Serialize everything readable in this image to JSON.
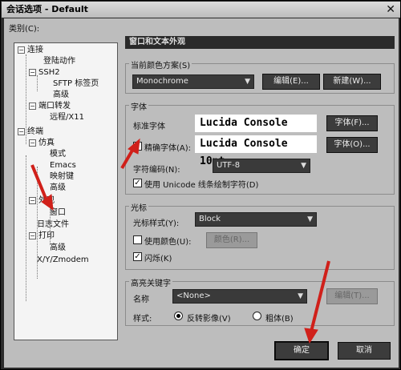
{
  "window": {
    "title": "会话选项 - Default",
    "close_glyph": "✕"
  },
  "category_label": "类别(C):",
  "tree": [
    {
      "label": "连接",
      "toggle": "−"
    },
    {
      "label": "登陆动作"
    },
    {
      "label": "SSH2",
      "toggle": "−"
    },
    {
      "label": "SFTP 标签页"
    },
    {
      "label": "高级"
    },
    {
      "label": "端口转发",
      "toggle": "−"
    },
    {
      "label": "远程/X11"
    },
    {
      "label": "终端",
      "toggle": "−"
    },
    {
      "label": "仿真",
      "toggle": "−"
    },
    {
      "label": "模式"
    },
    {
      "label": "Emacs"
    },
    {
      "label": "映射键"
    },
    {
      "label": "高级"
    },
    {
      "label": "外观",
      "toggle": "−"
    },
    {
      "label": "窗口"
    },
    {
      "label": "日志文件"
    },
    {
      "label": "打印",
      "toggle": "−"
    },
    {
      "label": "高级"
    },
    {
      "label": "X/Y/Zmodem"
    }
  ],
  "panel": {
    "title": "窗口和文本外观",
    "color_scheme": {
      "group_label": "当前颜色方案(S)",
      "value": "Monochrome",
      "edit_button": "编辑(E)...",
      "new_button": "新建(W)..."
    },
    "font": {
      "group_label": "字体",
      "normal_label": "标准字体",
      "normal_value": "Lucida Console 10pt",
      "normal_button": "字体(F)...",
      "precise_label": "精确字体(A):",
      "precise_checked": "✓",
      "precise_value": "Lucida Console 10pt",
      "precise_button": "字体(O)...",
      "encoding_label": "字符编码(N):",
      "encoding_value": "UTF-8",
      "unicode_checked": "✓",
      "unicode_label": "使用 Unicode 线条绘制字符(D)"
    },
    "cursor": {
      "group_label": "光标",
      "style_label": "光标样式(Y):",
      "style_value": "Block",
      "use_color_label": "使用颜色(U):",
      "use_color_checked": "",
      "color_button": "颜色(R)...",
      "blink_checked": "✓",
      "blink_label": "闪烁(K)"
    },
    "keyword": {
      "group_label": "高亮关键字",
      "name_label": "名称",
      "name_value": "<None>",
      "edit_button": "编辑(T)...",
      "style_label": "样式:",
      "reverse_label": "反转影像(V)",
      "bold_label": "粗体(B)"
    }
  },
  "footer": {
    "ok_button": "确定",
    "cancel_button": "取消"
  },
  "colors": {
    "annotation_arrow": "#d0201a",
    "dark_button": "#3c3c3c",
    "title_bar": "#2a2a2a"
  }
}
